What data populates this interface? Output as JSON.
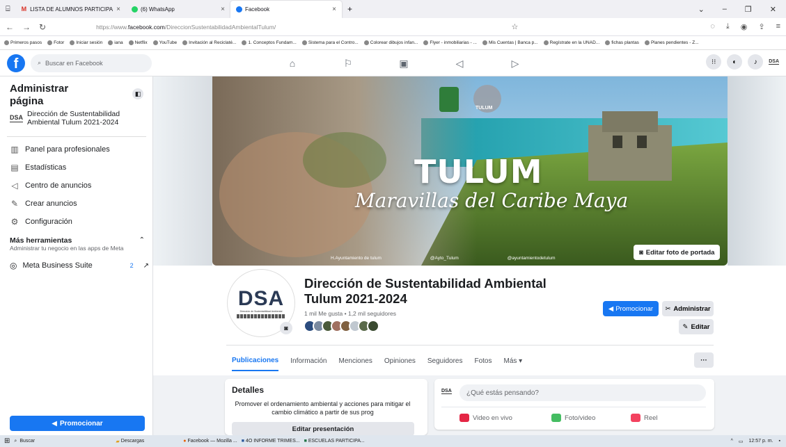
{
  "browser": {
    "tabs": [
      {
        "label": "LISTA DE ALUMNOS PARTICIPA",
        "close": "×"
      },
      {
        "label": "(6) WhatsApp",
        "close": "×"
      },
      {
        "label": "Facebook",
        "close": "×"
      }
    ],
    "new_tab": "+",
    "url_prefix": "https://www.",
    "url_domain": "facebook.com",
    "url_path": "/DireccionSustentabilidadAmbientalTulum/",
    "bookmarks": [
      "Primeros pasos",
      "Fotor",
      "Iniciar sesión",
      "iana",
      "Netflix",
      "YouTube",
      "Invitación al Reciclaté...",
      "1. Conceptos Fundam...",
      "Sistema para el Contro...",
      "Colorear dibujos infan...",
      "Flyer - inmobiliarias - ...",
      "Mis Cuentas | Banca p...",
      "Regístrate en la UNAD...",
      "fichas plantas",
      "Planes pendientes - Z..."
    ]
  },
  "fbnav": {
    "search_placeholder": "Buscar en Facebook",
    "user_badge": "DSA"
  },
  "sidebar": {
    "title": "Administrar página",
    "page_badge": "DSA",
    "page_name": "Dirección de Sustentabilidad Ambiental Tulum 2021-2024",
    "items": [
      {
        "label": "Panel para profesionales",
        "icon": "dashboard-icon"
      },
      {
        "label": "Estadísticas",
        "icon": "stats-icon"
      },
      {
        "label": "Centro de anuncios",
        "icon": "megaphone-icon"
      },
      {
        "label": "Crear anuncios",
        "icon": "edit-icon"
      },
      {
        "label": "Configuración",
        "icon": "gear-icon"
      }
    ],
    "tools_title": "Más herramientas",
    "tools_subtitle": "Administrar tu negocio en las apps de Meta",
    "meta_label": "Meta Business Suite",
    "meta_count": "2",
    "promote_label": "Promocionar"
  },
  "cover": {
    "title": "TULUM",
    "subtitle": "Maravillas del Caribe Maya",
    "logo_text": "TULUM",
    "credits": [
      "H.Ayuntamiento de tulum",
      "@Ayto_Tulum",
      "@ayuntamientodetulum"
    ],
    "edit_label": "Editar foto de portada"
  },
  "profile": {
    "avatar_text": "DSA",
    "avatar_small": "Dirección de Sustentabilidad Ambiental",
    "name": "Dirección de Sustentabilidad Ambiental Tulum 2021-2024",
    "stats": "1 mil Me gusta • 1,2 mil seguidores",
    "promote": "Promocionar",
    "manage": "Administrar",
    "edit": "Editar"
  },
  "tabs": [
    "Publicaciones",
    "Información",
    "Menciones",
    "Opiniones",
    "Seguidores",
    "Fotos",
    "Más ▾"
  ],
  "more_button": "···",
  "details": {
    "title": "Detalles",
    "text": "Promover el ordenamiento ambiental y acciones para mitigar el cambio climático a partir de sus prog",
    "button": "Editar presentación"
  },
  "composer": {
    "badge": "DSA",
    "placeholder": "¿Qué estás pensando?",
    "live": "Video en vivo",
    "photo": "Foto/video",
    "reel": "Reel"
  },
  "taskbar": {
    "search": "Buscar",
    "apps": [
      "Descargas",
      "Facebook — Mozilla ...",
      "4O INFORME TRIMES...",
      "ESCUELAS PARTICIPA..."
    ],
    "time": "12:57 p. m."
  },
  "colors": {
    "fb_blue": "#1877f2",
    "bg": "#f0f2f5"
  }
}
